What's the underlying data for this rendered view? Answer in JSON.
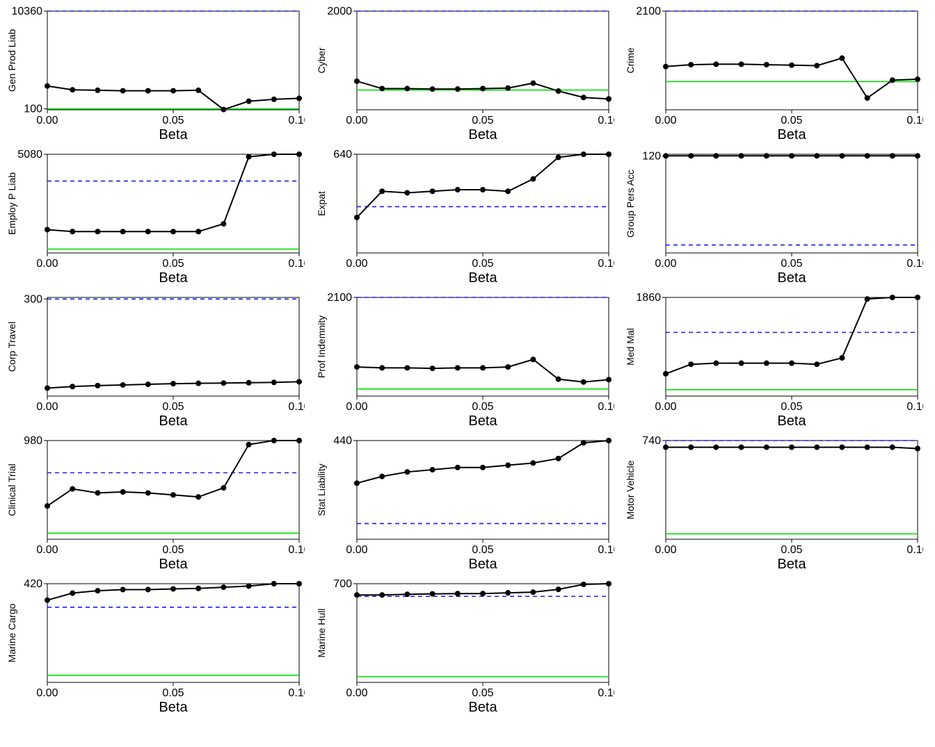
{
  "layout": {
    "xlabel": "Beta",
    "xTicks": [
      0.0,
      0.05,
      0.1
    ]
  },
  "chart_data": [
    {
      "name": "Gen Prod Liab",
      "type": "line",
      "ylabel": "Gen Prod Liab",
      "xlabel": "Beta",
      "x": [
        0,
        0.01,
        0.02,
        0.03,
        0.04,
        0.05,
        0.06,
        0.07,
        0.08,
        0.09,
        0.1
      ],
      "values": [
        2500,
        2100,
        2050,
        2000,
        2000,
        2000,
        2050,
        30,
        900,
        1100,
        1200
      ],
      "blue": 10360,
      "green": 100,
      "ylim": [
        0,
        10360
      ],
      "yTicks": [
        100,
        10360
      ]
    },
    {
      "name": "Cyber",
      "type": "line",
      "ylabel": "Cyber",
      "xlabel": "Beta",
      "x": [
        0,
        0.01,
        0.02,
        0.03,
        0.04,
        0.05,
        0.06,
        0.07,
        0.08,
        0.09,
        0.1
      ],
      "values": [
        580,
        430,
        430,
        420,
        420,
        430,
        440,
        540,
        380,
        250,
        220
      ],
      "blue": 2000,
      "green": 400,
      "ylim": [
        0,
        2000
      ],
      "yTicks": [
        2000
      ]
    },
    {
      "name": "Crime",
      "type": "line",
      "ylabel": "Crime",
      "xlabel": "Beta",
      "x": [
        0,
        0.01,
        0.02,
        0.03,
        0.04,
        0.05,
        0.06,
        0.07,
        0.08,
        0.09,
        0.1
      ],
      "values": [
        920,
        960,
        970,
        970,
        960,
        950,
        940,
        1100,
        250,
        630,
        650
      ],
      "blue": 2100,
      "green": 600,
      "ylim": [
        0,
        2100
      ],
      "yTicks": [
        2100
      ]
    },
    {
      "name": "Employ P Liab",
      "type": "line",
      "ylabel": "Employ P Liab",
      "xlabel": "Beta",
      "x": [
        0,
        0.01,
        0.02,
        0.03,
        0.04,
        0.05,
        0.06,
        0.07,
        0.08,
        0.09,
        0.1
      ],
      "values": [
        1200,
        1100,
        1100,
        1100,
        1100,
        1100,
        1100,
        1500,
        4950,
        5080,
        5080
      ],
      "blue": 3700,
      "green": 200,
      "ylim": [
        0,
        5080
      ],
      "yTicks": [
        5080
      ]
    },
    {
      "name": "Expat",
      "type": "line",
      "ylabel": "Expat",
      "xlabel": "Beta",
      "x": [
        0,
        0.01,
        0.02,
        0.03,
        0.04,
        0.05,
        0.06,
        0.07,
        0.08,
        0.09,
        0.1
      ],
      "values": [
        230,
        400,
        390,
        400,
        410,
        410,
        400,
        480,
        620,
        640,
        640
      ],
      "blue": 300,
      "green": null,
      "ylim": [
        0,
        640
      ],
      "yTicks": [
        640
      ]
    },
    {
      "name": "Group Pers Acc",
      "type": "line",
      "ylabel": "Group Pers Acc",
      "xlabel": "Beta",
      "x": [
        0,
        0.01,
        0.02,
        0.03,
        0.04,
        0.05,
        0.06,
        0.07,
        0.08,
        0.09,
        0.1
      ],
      "values": [
        120,
        120,
        120,
        120,
        120,
        120,
        120,
        120,
        120,
        120,
        120
      ],
      "blue": 8,
      "green": null,
      "ylim": [
        -2,
        122
      ],
      "yTicks": [
        120
      ]
    },
    {
      "name": "Corp Travel",
      "type": "line",
      "ylabel": "Corp Travel",
      "xlabel": "Beta",
      "x": [
        0,
        0.01,
        0.02,
        0.03,
        0.04,
        0.05,
        0.06,
        0.07,
        0.08,
        0.09,
        0.1
      ],
      "values": [
        20,
        25,
        28,
        30,
        32,
        34,
        35,
        36,
        37,
        38,
        40
      ],
      "blue": 300,
      "green": null,
      "ylim": [
        -5,
        305
      ],
      "yTicks": [
        300
      ]
    },
    {
      "name": "Prof Indemnity",
      "type": "line",
      "ylabel": "Prof Indemnity",
      "xlabel": "Beta",
      "x": [
        0,
        0.01,
        0.02,
        0.03,
        0.04,
        0.05,
        0.06,
        0.07,
        0.08,
        0.09,
        0.1
      ],
      "values": [
        620,
        600,
        600,
        590,
        600,
        600,
        620,
        780,
        360,
        300,
        350
      ],
      "blue": 2100,
      "green": 150,
      "ylim": [
        0,
        2100
      ],
      "yTicks": [
        2100
      ]
    },
    {
      "name": "Med Mal",
      "type": "line",
      "ylabel": "Med Mal",
      "xlabel": "Beta",
      "x": [
        0,
        0.01,
        0.02,
        0.03,
        0.04,
        0.05,
        0.06,
        0.07,
        0.08,
        0.09,
        0.1
      ],
      "values": [
        420,
        600,
        620,
        620,
        620,
        620,
        600,
        720,
        1830,
        1860,
        1860
      ],
      "blue": 1200,
      "green": 120,
      "ylim": [
        0,
        1860
      ],
      "yTicks": [
        1860
      ]
    },
    {
      "name": "Clinical Trial",
      "type": "line",
      "ylabel": "Clinical Trial",
      "xlabel": "Beta",
      "x": [
        0,
        0.01,
        0.02,
        0.03,
        0.04,
        0.05,
        0.06,
        0.07,
        0.08,
        0.09,
        0.1
      ],
      "values": [
        330,
        500,
        460,
        470,
        460,
        440,
        420,
        510,
        940,
        980,
        980
      ],
      "blue": 660,
      "green": 60,
      "ylim": [
        0,
        980
      ],
      "yTicks": [
        980
      ]
    },
    {
      "name": "Stat Liability",
      "type": "line",
      "ylabel": "Stat Liability",
      "xlabel": "Beta",
      "x": [
        0,
        0.01,
        0.02,
        0.03,
        0.04,
        0.05,
        0.06,
        0.07,
        0.08,
        0.09,
        0.1
      ],
      "values": [
        250,
        280,
        300,
        310,
        320,
        320,
        330,
        340,
        360,
        430,
        440
      ],
      "blue": 70,
      "green": null,
      "ylim": [
        0,
        440
      ],
      "yTicks": [
        440
      ]
    },
    {
      "name": "Motor Vehicle",
      "type": "line",
      "ylabel": "Motor Vehicle",
      "xlabel": "Beta",
      "x": [
        0,
        0.01,
        0.02,
        0.03,
        0.04,
        0.05,
        0.06,
        0.07,
        0.08,
        0.09,
        0.1
      ],
      "values": [
        690,
        690,
        690,
        690,
        690,
        690,
        690,
        690,
        690,
        690,
        680
      ],
      "blue": 740,
      "green": 40,
      "ylim": [
        0,
        740
      ],
      "yTicks": [
        740
      ]
    },
    {
      "name": "Marine Cargo",
      "type": "line",
      "ylabel": "Marine Cargo",
      "xlabel": "Beta",
      "x": [
        0,
        0.01,
        0.02,
        0.03,
        0.04,
        0.05,
        0.06,
        0.07,
        0.08,
        0.09,
        0.1
      ],
      "values": [
        350,
        380,
        390,
        395,
        395,
        398,
        400,
        405,
        410,
        420,
        420
      ],
      "blue": 320,
      "green": 30,
      "ylim": [
        0,
        420
      ],
      "yTicks": [
        420
      ]
    },
    {
      "name": "Marine Hull",
      "type": "line",
      "ylabel": "Marine Hull",
      "xlabel": "Beta",
      "x": [
        0,
        0.01,
        0.02,
        0.03,
        0.04,
        0.05,
        0.06,
        0.07,
        0.08,
        0.09,
        0.1
      ],
      "values": [
        620,
        620,
        625,
        628,
        630,
        630,
        635,
        640,
        660,
        695,
        700
      ],
      "blue": 610,
      "green": 40,
      "ylim": [
        0,
        700
      ],
      "yTicks": [
        700
      ]
    }
  ]
}
